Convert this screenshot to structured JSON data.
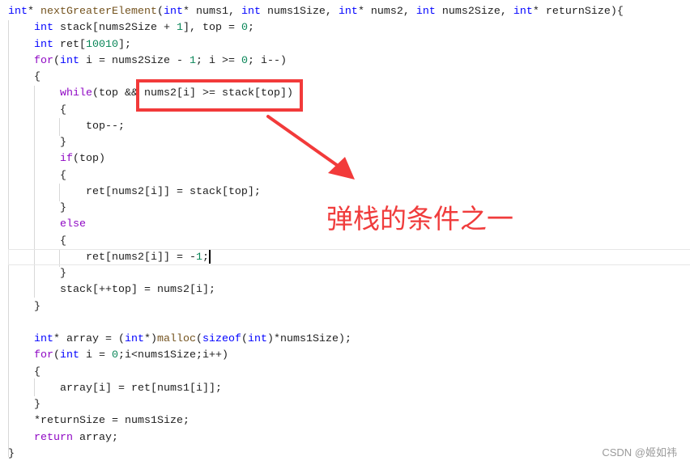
{
  "editor": {
    "lines": [
      [
        [
          "int",
          "k"
        ],
        [
          "* ",
          "p"
        ],
        [
          "nextGreaterElement",
          "f"
        ],
        [
          "(",
          "p"
        ],
        [
          "int",
          "k"
        ],
        [
          "* nums1, ",
          "p"
        ],
        [
          "int",
          "k"
        ],
        [
          " nums1Size, ",
          "p"
        ],
        [
          "int",
          "k"
        ],
        [
          "* nums2, ",
          "p"
        ],
        [
          "int",
          "k"
        ],
        [
          " nums2Size, ",
          "p"
        ],
        [
          "int",
          "k"
        ],
        [
          "* returnSize){",
          "p"
        ]
      ],
      [
        [
          "    ",
          "p"
        ],
        [
          "int",
          "k"
        ],
        [
          " stack[nums2Size + ",
          "p"
        ],
        [
          "1",
          "n"
        ],
        [
          "], top = ",
          "p"
        ],
        [
          "0",
          "n"
        ],
        [
          ";",
          "p"
        ]
      ],
      [
        [
          "    ",
          "p"
        ],
        [
          "int",
          "k"
        ],
        [
          " ret[",
          "p"
        ],
        [
          "10010",
          "n"
        ],
        [
          "];",
          "p"
        ]
      ],
      [
        [
          "    ",
          "p"
        ],
        [
          "for",
          "c"
        ],
        [
          "(",
          "p"
        ],
        [
          "int",
          "k"
        ],
        [
          " i = nums2Size - ",
          "p"
        ],
        [
          "1",
          "n"
        ],
        [
          "; i >= ",
          "p"
        ],
        [
          "0",
          "n"
        ],
        [
          "; i--)",
          "p"
        ]
      ],
      [
        [
          "    {",
          "p"
        ]
      ],
      [
        [
          "        ",
          "p"
        ],
        [
          "while",
          "c"
        ],
        [
          "(top && nums2[i] >= stack[top])",
          "p"
        ]
      ],
      [
        [
          "        {",
          "p"
        ]
      ],
      [
        [
          "            top--;",
          "p"
        ]
      ],
      [
        [
          "        }",
          "p"
        ]
      ],
      [
        [
          "        ",
          "p"
        ],
        [
          "if",
          "c"
        ],
        [
          "(top)",
          "p"
        ]
      ],
      [
        [
          "        {",
          "p"
        ]
      ],
      [
        [
          "            ret[nums2[i]] = stack[top];",
          "p"
        ]
      ],
      [
        [
          "        }",
          "p"
        ]
      ],
      [
        [
          "        ",
          "p"
        ],
        [
          "else",
          "c"
        ]
      ],
      [
        [
          "        {",
          "p"
        ]
      ],
      [
        [
          "            ret[nums2[i]] = -",
          "p"
        ],
        [
          "1",
          "n"
        ],
        [
          ";",
          "p"
        ]
      ],
      [
        [
          "        }",
          "p"
        ]
      ],
      [
        [
          "        stack[++top] = nums2[i];",
          "p"
        ]
      ],
      [
        [
          "    }",
          "p"
        ]
      ],
      [
        [
          "",
          "p"
        ]
      ],
      [
        [
          "    ",
          "p"
        ],
        [
          "int",
          "k"
        ],
        [
          "* array = (",
          "p"
        ],
        [
          "int",
          "k"
        ],
        [
          "*)",
          "p"
        ],
        [
          "malloc",
          "f"
        ],
        [
          "(",
          "p"
        ],
        [
          "sizeof",
          "k"
        ],
        [
          "(",
          "p"
        ],
        [
          "int",
          "k"
        ],
        [
          ")*nums1Size);",
          "p"
        ]
      ],
      [
        [
          "    ",
          "p"
        ],
        [
          "for",
          "c"
        ],
        [
          "(",
          "p"
        ],
        [
          "int",
          "k"
        ],
        [
          " i = ",
          "p"
        ],
        [
          "0",
          "n"
        ],
        [
          ";i<nums1Size;i++)",
          "p"
        ]
      ],
      [
        [
          "    {",
          "p"
        ]
      ],
      [
        [
          "        array[i] = ret[nums1[i]];",
          "p"
        ]
      ],
      [
        [
          "    }",
          "p"
        ]
      ],
      [
        [
          "    *returnSize = nums1Size;",
          "p"
        ]
      ],
      [
        [
          "    ",
          "p"
        ],
        [
          "return",
          "c"
        ],
        [
          " array;",
          "p"
        ]
      ],
      [
        [
          "}",
          "p"
        ]
      ]
    ],
    "current_line": 16
  },
  "annotation": {
    "text": "弹栈的条件之一",
    "color": "#f03c3c"
  },
  "watermark": "CSDN @姬如祎"
}
